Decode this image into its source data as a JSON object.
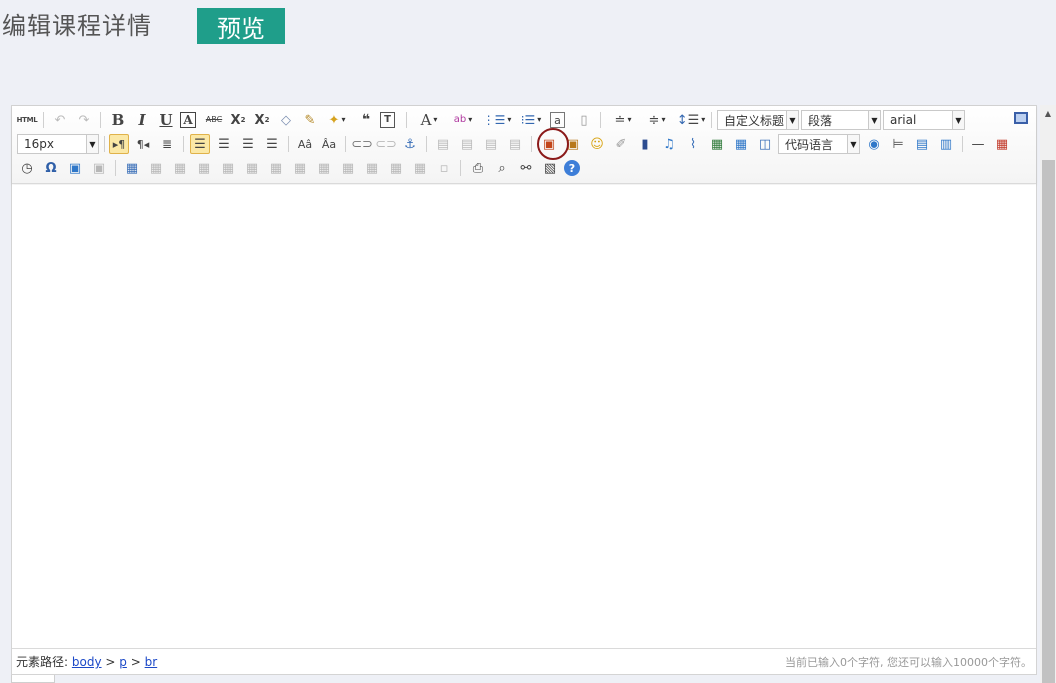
{
  "header": {
    "title": "编辑课程详情",
    "preview_label": "预览"
  },
  "toolbar": {
    "row1": [
      {
        "name": "html-source-icon",
        "glyph": "HTML"
      },
      {
        "name": "undo-icon",
        "glyph": "↶"
      },
      {
        "name": "redo-icon",
        "glyph": "↷"
      },
      {
        "name": "bold-icon",
        "glyph": "B"
      },
      {
        "name": "italic-icon",
        "glyph": "I"
      },
      {
        "name": "underline-icon",
        "glyph": "U"
      },
      {
        "name": "font-border-icon",
        "glyph": "A"
      },
      {
        "name": "strikethrough-icon",
        "glyph": "ABC"
      },
      {
        "name": "superscript-icon",
        "glyph": "X²"
      },
      {
        "name": "subscript-icon",
        "glyph": "X₂"
      },
      {
        "name": "eraser-icon",
        "glyph": "◇"
      },
      {
        "name": "format-painter-icon",
        "glyph": "✎"
      },
      {
        "name": "auto-typeset-icon",
        "glyph": "✦"
      },
      {
        "name": "blockquote-icon",
        "glyph": "❝❝"
      },
      {
        "name": "paste-plain-icon",
        "glyph": "T"
      },
      {
        "name": "font-color-icon",
        "glyph": "A"
      },
      {
        "name": "highlight-color-icon",
        "glyph": "ab"
      },
      {
        "name": "ordered-list-icon",
        "glyph": "1☰"
      },
      {
        "name": "unordered-list-icon",
        "glyph": "•☰"
      },
      {
        "name": "select-all-icon",
        "glyph": "a"
      },
      {
        "name": "clear-doc-icon",
        "glyph": "▯"
      },
      {
        "name": "row-spacing-top-icon",
        "glyph": "≐"
      },
      {
        "name": "row-spacing-bottom-icon",
        "glyph": "≑"
      },
      {
        "name": "line-height-icon",
        "glyph": "↕☰"
      }
    ],
    "custom_heading": "自定义标题",
    "paragraph": "段落",
    "font_family": "arial",
    "font_size": "16px",
    "code_language": "代码语言",
    "fullscreen_icon": "fullscreen-icon"
  },
  "status": {
    "path_label": "元素路径:",
    "path": [
      "body",
      "p",
      "br"
    ],
    "path_sep": ">",
    "count_text": "当前已输入0个字符, 您还可以输入10000个字符。"
  },
  "colors": {
    "accent": "#1f9e8a",
    "background": "#eef0f6",
    "highlight_circle": "#8b1a1a"
  }
}
